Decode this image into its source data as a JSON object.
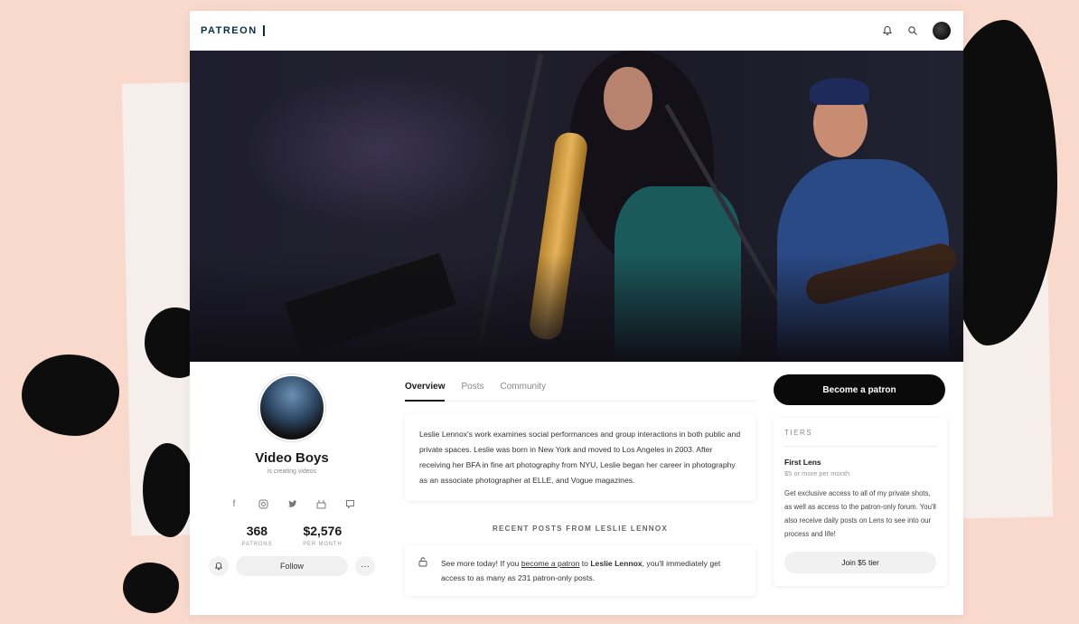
{
  "topbar": {
    "logo": "PATREON",
    "icons": [
      "bell-icon",
      "search-icon",
      "user-avatar"
    ]
  },
  "creator": {
    "name": "Video Boys",
    "subtitle": "is creating videos",
    "socials": [
      "facebook-icon",
      "instagram-icon",
      "twitter-icon",
      "youtube-icon",
      "discord-icon"
    ],
    "patrons_value": "368",
    "patrons_label": "PATRONS",
    "monthly_value": "$2,576",
    "monthly_label": "PER MONTH",
    "follow_label": "Follow",
    "more_label": "···"
  },
  "tabs": [
    "Overview",
    "Posts",
    "Community"
  ],
  "about": "Leslie Lennox's work examines social performances and group interactions in both public and private spaces. Leslie was born in New York and moved to Los Angeles in 2003. After receiving her BFA in fine art photography from NYU, Leslie began her career in photography as an associate photographer at ELLE, and Vogue magazines.",
  "recent": {
    "heading": "RECENT POSTS FROM LESLIE LENNOX",
    "text_before": "See more today! If you ",
    "link": "become a patron",
    "text_mid": " to ",
    "creator_bold": "Leslie Lennox",
    "text_after": ", you'll immediately get access to as many as 231 patron-only posts."
  },
  "sidebar": {
    "become_label": "Become a patron",
    "tiers_heading": "TIERS",
    "tier_name": "First Lens",
    "tier_price": "$5 or more per month",
    "tier_desc": "Get exclusive access to all of my private shots, as well as access to the patron-only forum. You'll also receive daily posts on Lens to see into our process and life!",
    "join_label": "Join $5 tier"
  }
}
